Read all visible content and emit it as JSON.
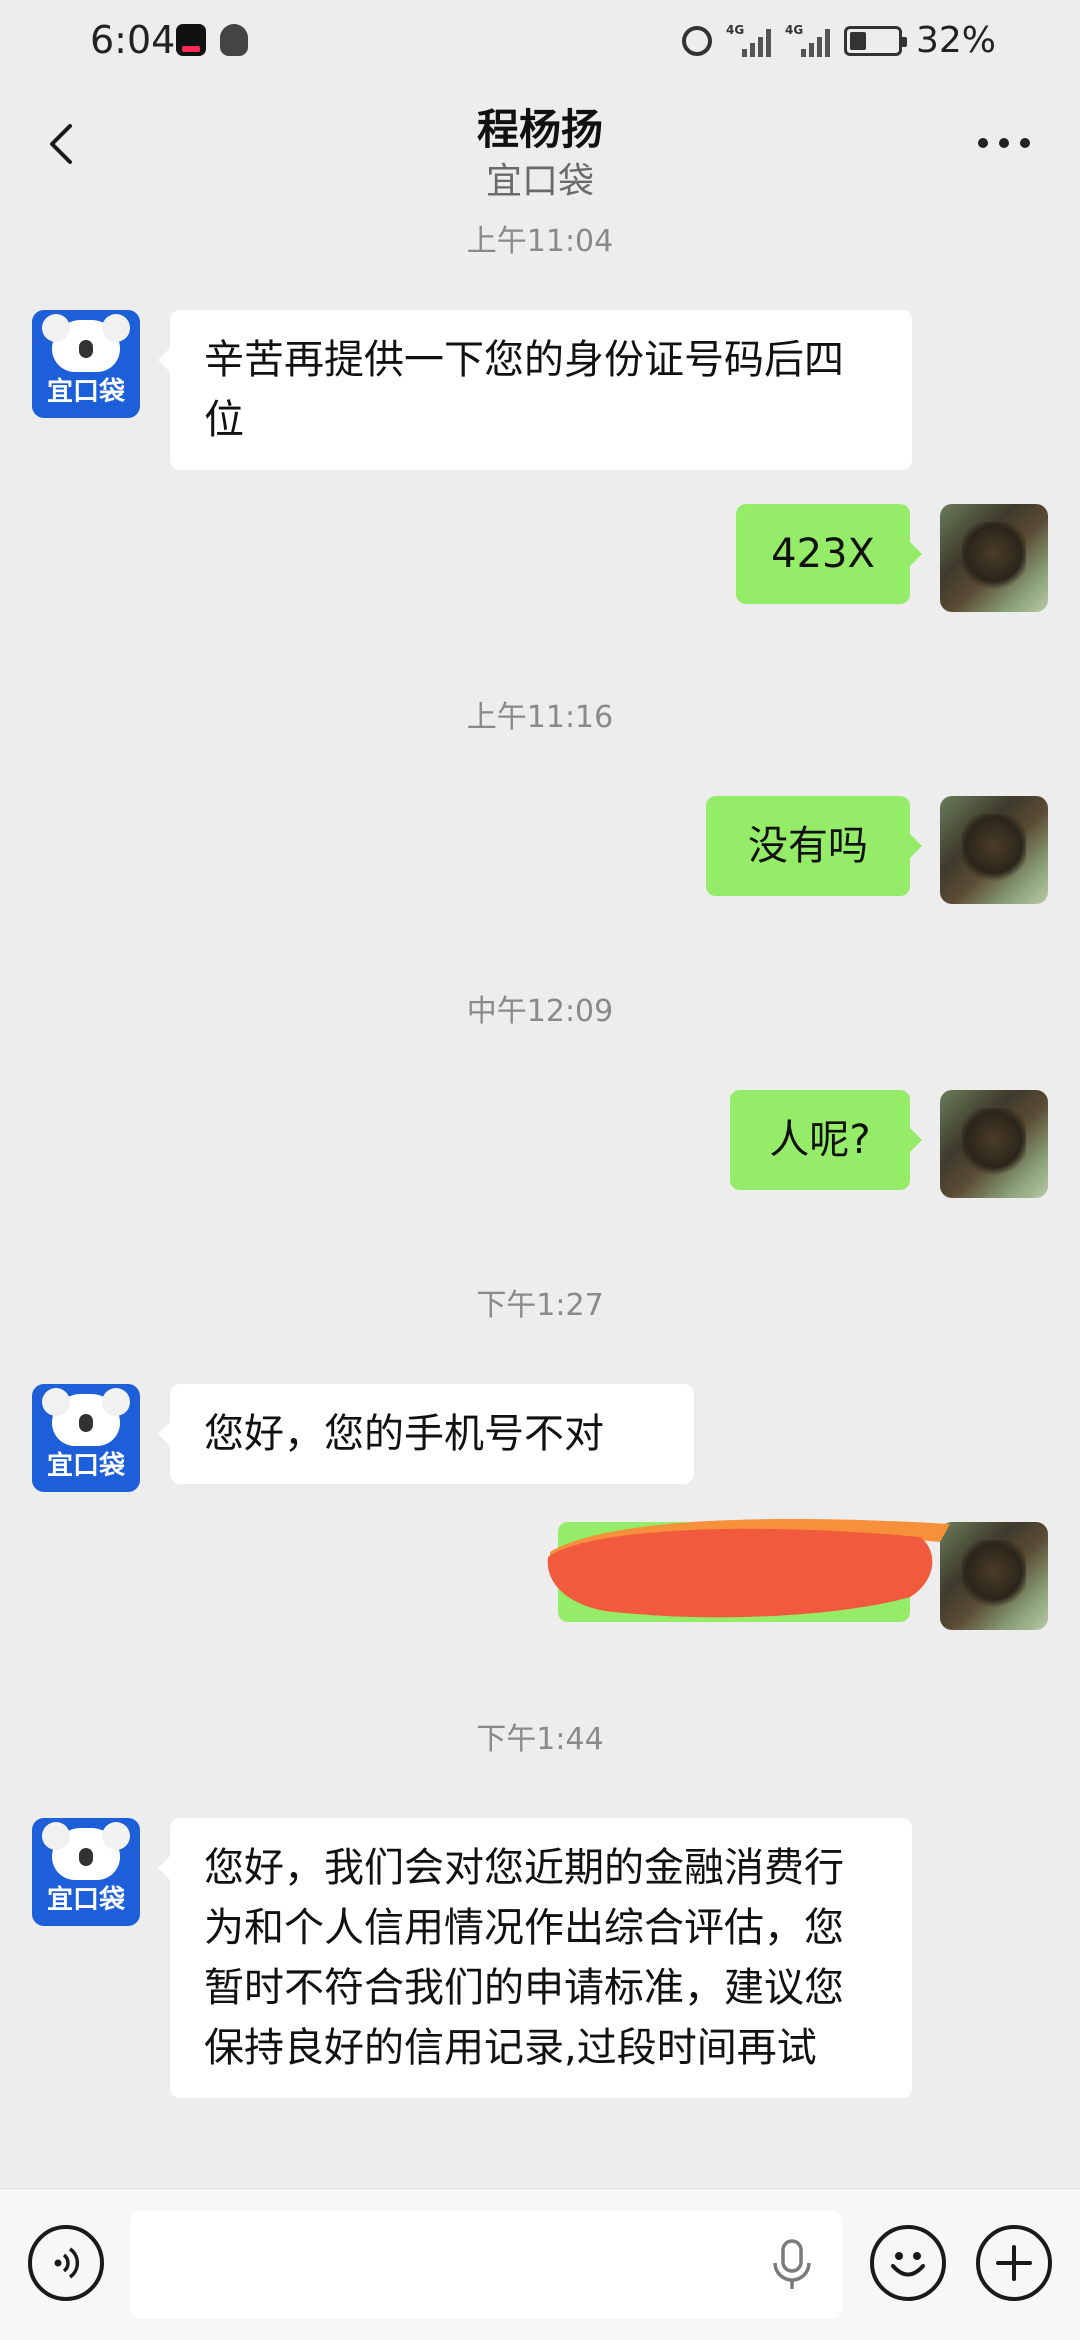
{
  "status_bar": {
    "time": "6:04",
    "battery": "32%",
    "network_tag_1": "4G",
    "network_tag_2": "4G",
    "icons": [
      "tiktok-icon",
      "qq-icon",
      "alarm-icon",
      "signal-icon",
      "signal-icon",
      "battery-icon"
    ]
  },
  "header": {
    "title": "程杨扬",
    "subtitle": "宜口袋",
    "back_icon": "chevron-left-icon",
    "more_icon": "more-dots-icon"
  },
  "brand_avatar_text": "宜口袋",
  "messages": {
    "ts1": "上午11:04",
    "m1": "辛苦再提供一下您的身份证号码后四位",
    "m2": "423X",
    "ts2": "上午11:16",
    "m3": "没有吗",
    "ts3": "中午12:09",
    "m4": "人呢?",
    "ts4": "下午1:27",
    "m5": "您好，您的手机号不对",
    "ts5": "下午1:44",
    "m7": "您好，我们会对您近期的金融消费行为和个人信用情况作出综合评估，您暂时不符合我们的申请标准，建议您保持良好的信用记录,过段时间再试"
  },
  "input_bar": {
    "value": "",
    "icons": [
      "voice-icon",
      "mic-icon",
      "emoji-icon",
      "plus-icon"
    ]
  },
  "colors": {
    "background": "#ededed",
    "incoming_bubble": "#ffffff",
    "outgoing_bubble": "#95ec69",
    "brand_avatar": "#1c5fd8",
    "redaction": "#f25a3e"
  }
}
